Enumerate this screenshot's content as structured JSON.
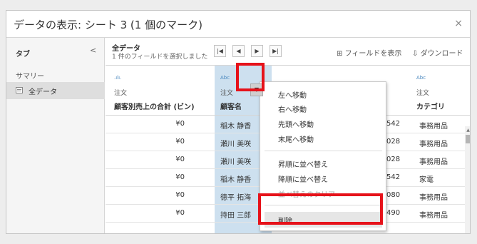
{
  "dialog": {
    "title": "データの表示: シート 3 (1 個のマーク)",
    "close_icon": "×"
  },
  "sidebar": {
    "tab_label": "タブ",
    "collapse_icon": "<",
    "summary": "サマリー",
    "all_data": "全データ"
  },
  "toolbar": {
    "title": "全データ",
    "caption": "1 件のフィールドを選択しました",
    "nav": [
      "|◀",
      "◀",
      "▶",
      "▶|"
    ],
    "show_fields": "フィールドを表示",
    "download": "ダウンロード"
  },
  "columns": [
    {
      "type": ".ılı.",
      "source": "注文",
      "name": "顧客別売上の合計 (ビン)"
    },
    {
      "type": "Abc",
      "source": "注文",
      "name": "顧客名"
    },
    {
      "type": "Abc",
      "source": "注文",
      "name": "カテゴリ"
    }
  ],
  "rows": [
    {
      "sales": "¥0",
      "name": "稲木 静香",
      "num": "542",
      "category": "事務用品"
    },
    {
      "sales": "¥0",
      "name": "瀬川 美咲",
      "num": "028",
      "category": "事務用品"
    },
    {
      "sales": "¥0",
      "name": "瀬川 美咲",
      "num": "028",
      "category": "事務用品"
    },
    {
      "sales": "¥0",
      "name": "稲木 静香",
      "num": "542",
      "category": "家電"
    },
    {
      "sales": "¥0",
      "name": "徳平 拓海",
      "num": "080",
      "category": "事務用品"
    },
    {
      "sales": "¥0",
      "name": "持田 三郎",
      "num": "490",
      "category": "事務用品"
    }
  ],
  "context_menu": {
    "move": [
      "左へ移動",
      "右へ移動",
      "先頭へ移動",
      "末尾へ移動"
    ],
    "sort": [
      "昇順に並べ替え",
      "降順に並べ替え"
    ],
    "clear_sort": "並べ替えのクリア",
    "delete": "削除"
  },
  "colors": {
    "highlight": "#e6121a",
    "selected_column": "#cde0ef"
  }
}
